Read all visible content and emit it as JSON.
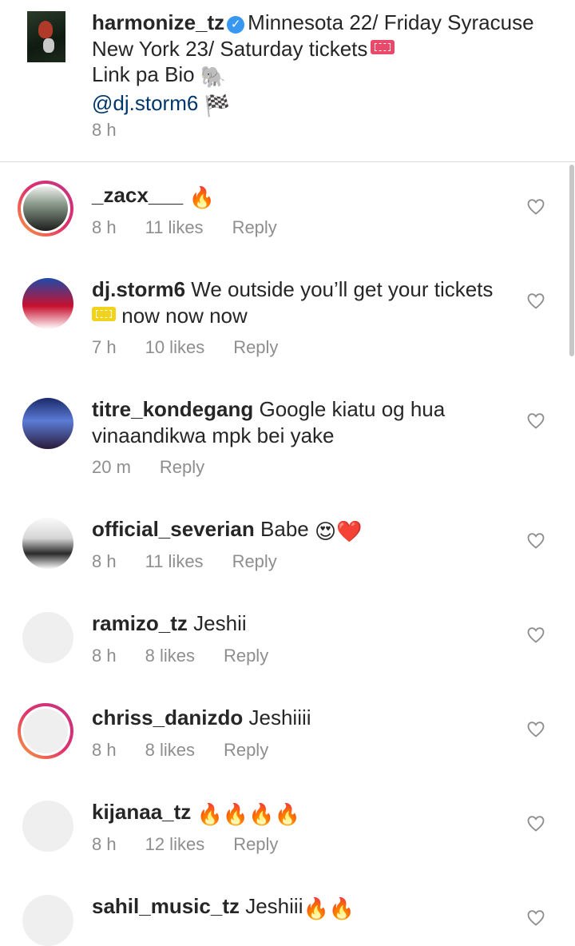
{
  "caption": {
    "username": "harmonize_tz",
    "text": "Minnesota 22/ Friday Syracuse New York 23/ Saturday tickets",
    "line2": "Link pa Bio",
    "mention": "@dj.storm6",
    "time": "8 h"
  },
  "comments": [
    {
      "username": "_zacx___",
      "text": "",
      "emoji": "🔥",
      "time": "8 h",
      "likes": "11 likes",
      "reply": "Reply"
    },
    {
      "username": "dj.storm6",
      "text": "We outside you’ll get your tickets",
      "text2": "now now now",
      "time": "7 h",
      "likes": "10 likes",
      "reply": "Reply"
    },
    {
      "username": "titre_kondegang",
      "text": "Google kiatu og hua vinaandikwa mpk bei yake",
      "time": "20 m",
      "reply": "Reply"
    },
    {
      "username": "official_severian",
      "text": "Babe",
      "emoji": "😍❤️",
      "time": "8 h",
      "likes": "11 likes",
      "reply": "Reply"
    },
    {
      "username": "ramizo_tz",
      "text": "Jeshii",
      "time": "8 h",
      "likes": "8 likes",
      "reply": "Reply"
    },
    {
      "username": "chriss_danizdo",
      "text": "Jeshiiii",
      "time": "8 h",
      "likes": "8 likes",
      "reply": "Reply"
    },
    {
      "username": "kijanaa_tz",
      "text": "",
      "emoji": "🔥🔥🔥🔥",
      "time": "8 h",
      "likes": "12 likes",
      "reply": "Reply"
    },
    {
      "username": "sahil_music_tz",
      "text": "Jeshiii",
      "emoji": "🔥🔥"
    }
  ],
  "icons": {
    "heart": "heart-outline-icon",
    "verified": "verified-badge-icon",
    "elephant": "elephant-icon",
    "flag": "checkered-flag-icon",
    "ticket": "ticket-icon"
  },
  "colors": {
    "text": "#262626",
    "meta": "#8e8e8e",
    "mention": "#00376b",
    "verified": "#3897f0"
  }
}
